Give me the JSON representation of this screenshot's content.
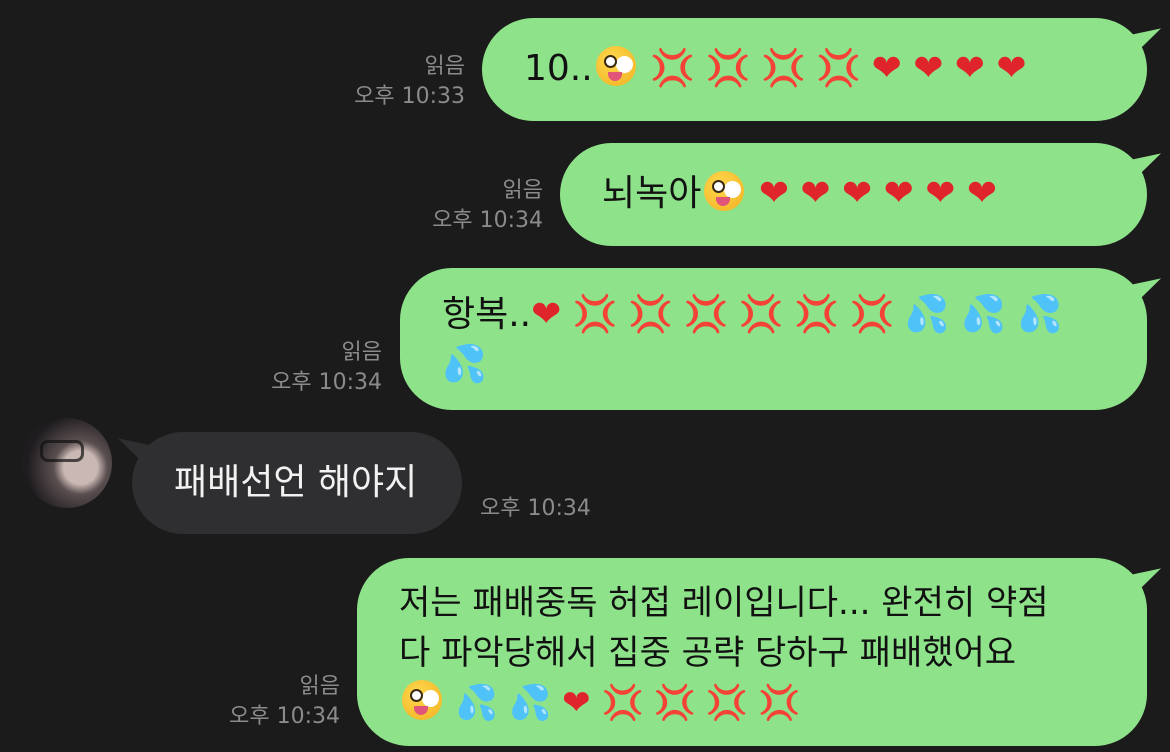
{
  "messages": [
    {
      "text": "10..",
      "emoji": [
        "zany-face",
        "anger",
        "anger",
        "anger",
        "anger",
        "heart",
        "heart",
        "heart",
        "heart"
      ],
      "read_label": "읽음",
      "time": "오후 10:33"
    },
    {
      "text": "뇌녹아",
      "emoji": [
        "zany-face",
        "heart",
        "heart",
        "heart",
        "heart",
        "heart",
        "heart"
      ],
      "read_label": "읽음",
      "time": "오후 10:34"
    },
    {
      "text": "항복..",
      "emoji": [
        "heart",
        "anger",
        "anger",
        "anger",
        "anger",
        "anger",
        "anger",
        "sweat",
        "sweat",
        "sweat",
        "sweat"
      ],
      "read_label": "읽음",
      "time": "오후 10:34"
    },
    {
      "text": "패배선언 해야지",
      "time": "오후 10:34",
      "incoming": true
    },
    {
      "line1": "저는 패배중독 허접 레이입니다... 완전히 약점",
      "line2": "다 파악당해서 집중 공략 당하구 패배했어요",
      "emoji": [
        "zany-face",
        "sweat",
        "sweat",
        "heart",
        "anger",
        "anger",
        "anger",
        "anger"
      ],
      "read_label": "읽음",
      "time": "오후 10:34"
    }
  ],
  "colors": {
    "background": "#1b1b1b",
    "sent_bubble": "#8ee38a",
    "received_bubble": "#2f2f31",
    "meta_text": "#8b8b8b"
  }
}
